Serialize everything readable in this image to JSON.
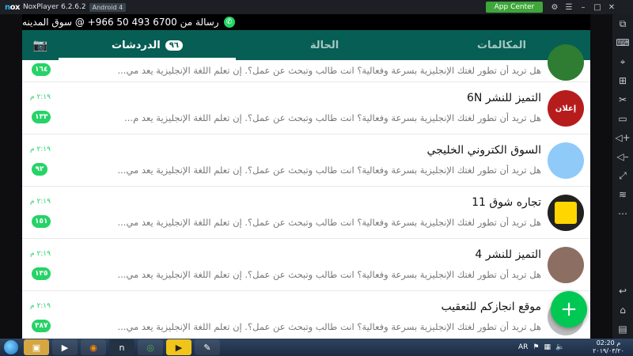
{
  "nox": {
    "logo_a": "n",
    "logo_b": "ox",
    "version": "NoxPlayer 6.2.6.2",
    "android": "Android 4",
    "app_center": "App Center"
  },
  "notification": {
    "text": "رسالة من 6700 493 50 966+ @ سوق المدينه"
  },
  "tabs": [
    {
      "label": "الدردشات",
      "badge": "٩٦",
      "active": true
    },
    {
      "label": "الحالة",
      "active": false
    },
    {
      "label": "المكالمات",
      "active": false
    }
  ],
  "preview_text": "هل تريد أن تطور لغتك الإنجليزية بسرعة وفعالية؟ انت طالب وتبحث عن عمل؟. إن تعلم اللغة الإنجليزية يعد مي...",
  "chats": [
    {
      "name": "",
      "preview": "هل تريد أن تطور لغتك الإنجليزية بسرعة وفعالية؟ انت طالب وتبحث عن عمل؟. إن تعلم اللغة الإنجليزية يعد مي...",
      "time": "",
      "unread": "١٦٤",
      "avatar_color": "#2e7d32"
    },
    {
      "name": "التميز للنشر 6N",
      "preview": "هل تريد أن تطور لغتك الإنجليزية بسرعة وفعالية؟ انت طالب وتبحث عن عمل؟. إن تعلم اللغة الإنجليزية يعد م...",
      "time": "٢:١٩ م",
      "unread": "١٣٣",
      "avatar_color": "#b71c1c"
    },
    {
      "name": "السوق الكتروني الخليجي",
      "preview": "هل تريد أن تطور لغتك الإنجليزية بسرعة وفعالية؟ انت طالب وتبحث عن عمل؟. إن تعلم اللغة الإنجليزية يعد مي...",
      "time": "٢:١٩ م",
      "unread": "٩٢",
      "avatar_color": "#90caf9"
    },
    {
      "name": "تجاره شوق 11",
      "preview": "هل تريد أن تطور لغتك الإنجليزية بسرعة وفعالية؟ انت طالب وتبحث عن عمل؟. إن تعلم اللغة الإنجليزية يعد مي...",
      "time": "٢:١٩ م",
      "unread": "١٥١",
      "avatar_color": "#212121"
    },
    {
      "name": "التميز للنشر 4",
      "preview": "هل تريد أن تطور لغتك الإنجليزية بسرعة وفعالية؟ انت طالب وتبحث عن عمل؟. إن تعلم اللغة الإنجليزية يعد مي...",
      "time": "٢:١٩ م",
      "unread": "١٣٥",
      "avatar_color": "#8d6e63"
    },
    {
      "name": "موقع انجازكم للتعقيب",
      "preview": "هل تريد أن تطور لغتك الإنجليزية بسرعة وفعالية؟ انت طالب وتبحث عن عمل؟. إن تعلم اللغة الإنجليزية يعد مي...",
      "time": "٢:١٩ م",
      "unread": "٣٨٧",
      "avatar_color": "#bdbdbd"
    }
  ],
  "fab_label": "+",
  "taskbar": {
    "lang": "AR",
    "time": "02:20 م",
    "date": "٢٠١٩/٠٣/٢٠"
  }
}
